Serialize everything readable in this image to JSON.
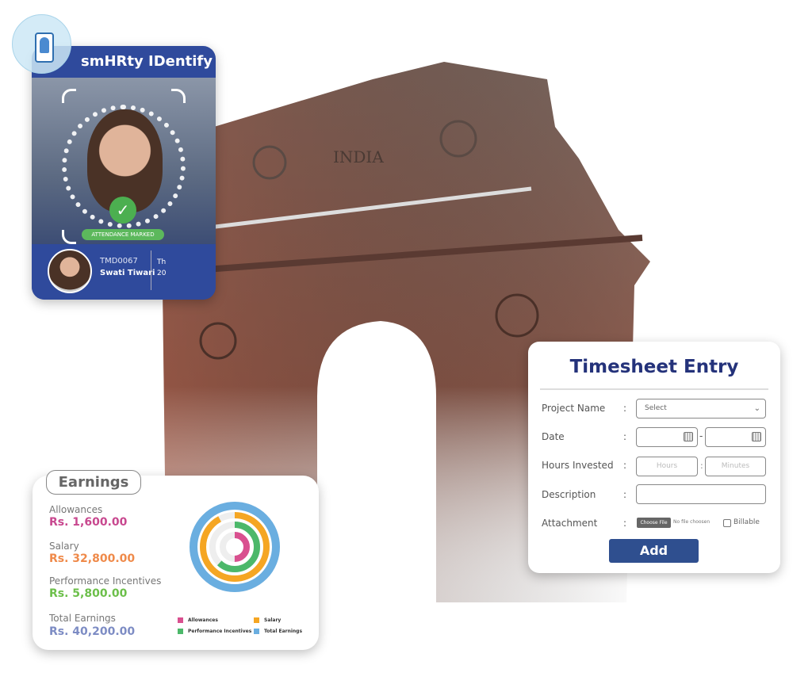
{
  "id_card": {
    "title": "smHRty IDentify",
    "status": "ATTENDANCE MARKED",
    "employee_id": "TMD0067",
    "employee_name": "Swati Tiwari",
    "extra_lines": [
      "Th",
      "20"
    ],
    "accent": "#2f4a9c"
  },
  "monument": {
    "inscription": "INDIA"
  },
  "timesheet": {
    "title": "Timesheet Entry",
    "fields": [
      {
        "label": "Project Name",
        "value": "Select"
      },
      {
        "label": "Date"
      },
      {
        "label": "Hours Invested",
        "placeholders": [
          "Hours",
          "Minutes"
        ]
      },
      {
        "label": "Description"
      },
      {
        "label": "Attachment",
        "button": "Choose File",
        "file_status": "No file choosen",
        "checkbox": "Billable",
        "checked": false
      }
    ],
    "separator": ":",
    "range_sep": "-",
    "submit": "Add",
    "accent": "#2f4f8f"
  },
  "earnings": {
    "title": "Earnings",
    "items": [
      {
        "label": "Allowances",
        "value": "Rs. 1,600.00",
        "color": "#c8488f"
      },
      {
        "label": "Salary",
        "value": "Rs. 32,800.00",
        "color": "#ef8a4a"
      },
      {
        "label": "Performance Incentives",
        "value": "Rs. 5,800.00",
        "color": "#6cbf4a"
      },
      {
        "label": "Total Earnings",
        "value": "Rs. 40,200.00",
        "color": "#7d8cc4"
      }
    ]
  },
  "chart_data": {
    "type": "radial-bar",
    "series": [
      {
        "name": "Allowances",
        "fraction": 0.5,
        "color": "#d9508f"
      },
      {
        "name": "Performance Incentives",
        "fraction": 0.62,
        "color": "#4cb86a"
      },
      {
        "name": "Salary",
        "fraction": 0.92,
        "color": "#f5a623"
      },
      {
        "name": "Total Earnings",
        "fraction": 1.0,
        "color": "#6aaee0"
      }
    ],
    "legend": "bottom"
  }
}
